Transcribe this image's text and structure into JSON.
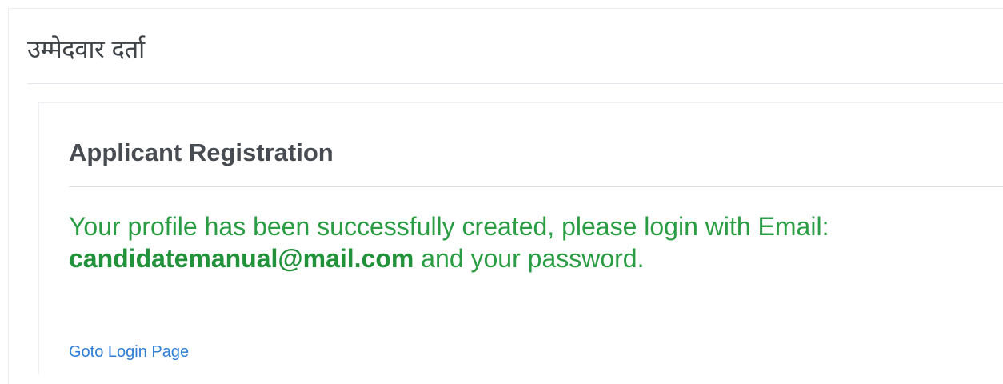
{
  "page": {
    "heading": "उम्मेदवार दर्ता"
  },
  "card": {
    "title": "Applicant Registration",
    "message": {
      "prefix": "Your profile has been successfully created, please login with Email:",
      "email": "candidatemanual@mail.com",
      "suffix": " and your password."
    },
    "login_link": "Goto Login Page"
  },
  "colors": {
    "success_text": "#2a9d44",
    "link": "#2f7fd6",
    "heading": "#3f4448"
  }
}
